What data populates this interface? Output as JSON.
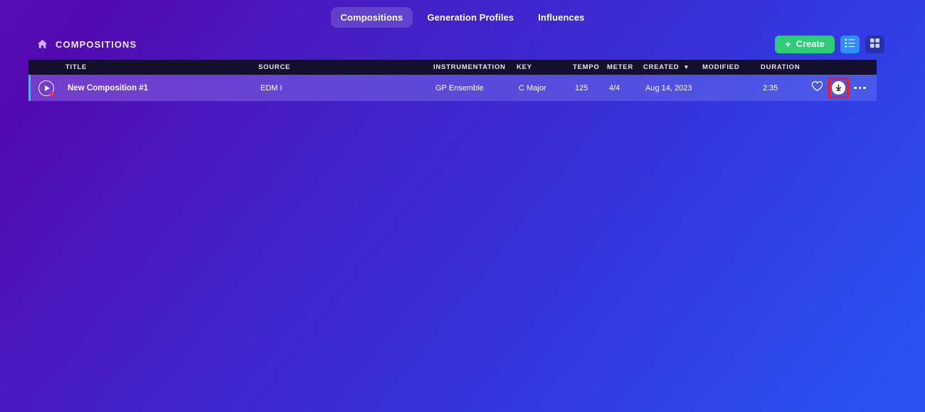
{
  "nav": {
    "tabs": [
      {
        "label": "Compositions",
        "active": true
      },
      {
        "label": "Generation Profiles",
        "active": false
      },
      {
        "label": "Influences",
        "active": false
      }
    ]
  },
  "header": {
    "home_icon": "home-icon",
    "breadcrumb": "COMPOSITIONS",
    "create_label": "Create",
    "create_plus": "+",
    "create_color": "#2ecc7a",
    "list_view_icon": "list-view-icon",
    "grid_view_icon": "grid-view-icon",
    "active_view": "list"
  },
  "table": {
    "columns": [
      {
        "key": "title",
        "label": "TITLE"
      },
      {
        "key": "source",
        "label": "SOURCE"
      },
      {
        "key": "instrumentation",
        "label": "INSTRUMENTATION"
      },
      {
        "key": "key",
        "label": "KEY"
      },
      {
        "key": "tempo",
        "label": "TEMPO"
      },
      {
        "key": "meter",
        "label": "METER"
      },
      {
        "key": "created",
        "label": "CREATED"
      },
      {
        "key": "modified",
        "label": "MODIFIED"
      },
      {
        "key": "duration",
        "label": "DURATION"
      }
    ],
    "sort": {
      "column": "CREATED",
      "direction": "desc",
      "caret": "▼"
    },
    "rows": [
      {
        "play_icon": "play-icon",
        "title": "New Composition #1",
        "source": "EDM I",
        "instrumentation": "GP Ensemble",
        "key": "C Major",
        "tempo": "125",
        "meter": "4/4",
        "created": "Aug 14, 2023",
        "modified": "",
        "duration": "2:35",
        "favorite_icon": "heart-icon",
        "download_icon": "download-icon",
        "more_icon": "more-options-icon"
      }
    ]
  },
  "annotation": {
    "highlight_target": "download-icon",
    "highlight_color": "#ed1c24"
  }
}
